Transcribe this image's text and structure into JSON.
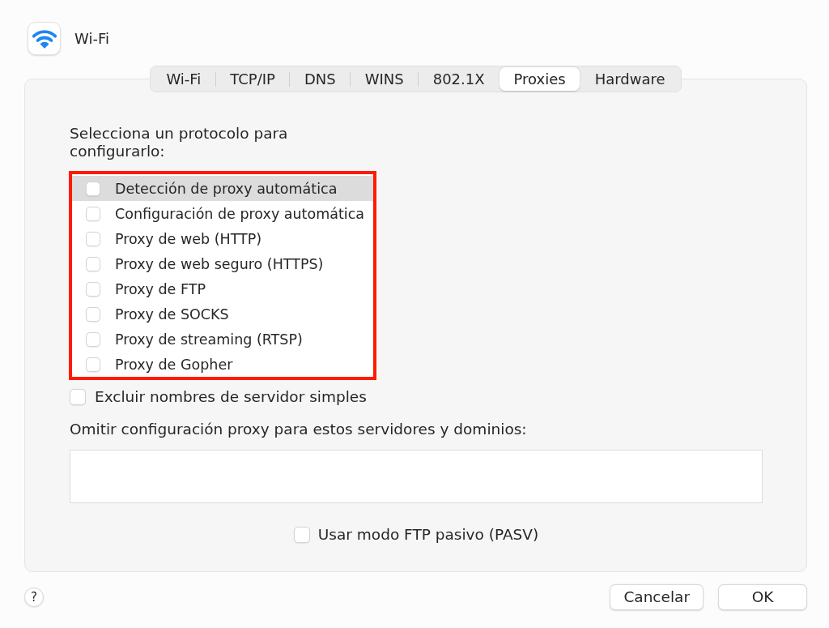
{
  "window": {
    "title": "Wi-Fi"
  },
  "tabs": [
    {
      "label": "Wi-Fi",
      "selected": false
    },
    {
      "label": "TCP/IP",
      "selected": false
    },
    {
      "label": "DNS",
      "selected": false
    },
    {
      "label": "WINS",
      "selected": false
    },
    {
      "label": "802.1X",
      "selected": false
    },
    {
      "label": "Proxies",
      "selected": true
    },
    {
      "label": "Hardware",
      "selected": false
    }
  ],
  "protocols": {
    "heading": "Selecciona un protocolo para configurarlo:",
    "items": [
      {
        "label": "Detección de proxy automática",
        "selected": true,
        "checked": false
      },
      {
        "label": "Configuración de proxy automática",
        "selected": false,
        "checked": false
      },
      {
        "label": "Proxy de web (HTTP)",
        "selected": false,
        "checked": false
      },
      {
        "label": "Proxy de web seguro (HTTPS)",
        "selected": false,
        "checked": false
      },
      {
        "label": "Proxy de FTP",
        "selected": false,
        "checked": false
      },
      {
        "label": "Proxy de SOCKS",
        "selected": false,
        "checked": false
      },
      {
        "label": "Proxy de streaming (RTSP)",
        "selected": false,
        "checked": false
      },
      {
        "label": "Proxy de Gopher",
        "selected": false,
        "checked": false
      }
    ]
  },
  "exclude_simple_hostnames": {
    "label": "Excluir nombres de servidor simples",
    "checked": false
  },
  "bypass": {
    "label": "Omitir configuración proxy para estos servidores y dominios:"
  },
  "passive_ftp": {
    "label": "Usar modo FTP pasivo (PASV)",
    "checked": false
  },
  "help_button": {
    "label": "?"
  },
  "buttons": [
    "Cancelar",
    "OK"
  ]
}
